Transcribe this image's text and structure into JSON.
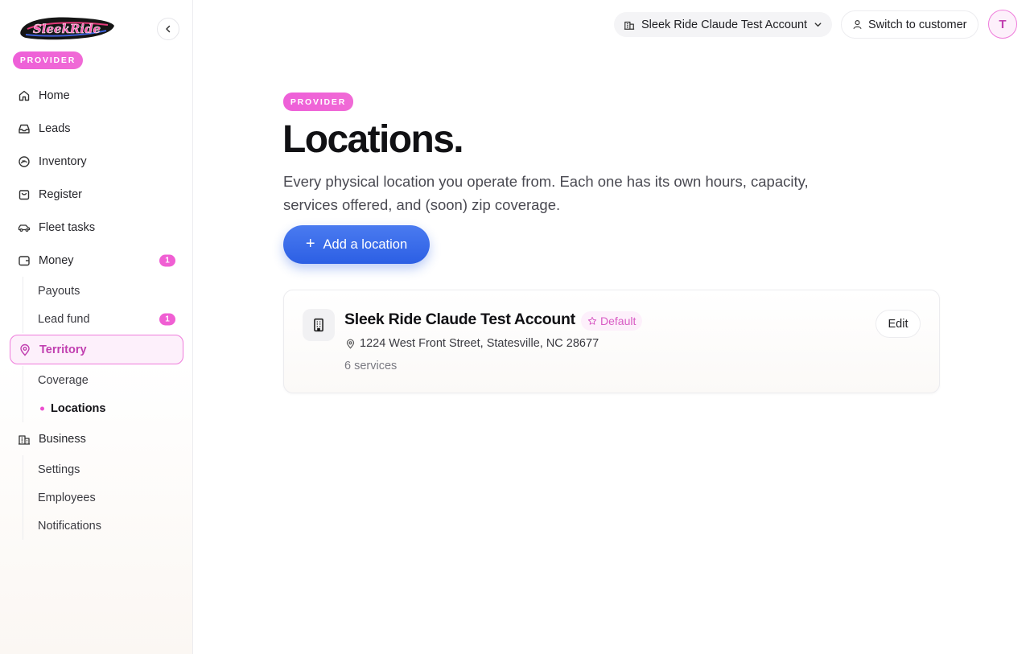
{
  "brand": {
    "logo_text": "SleekRide",
    "role_badge": "PROVIDER",
    "accent_color": "#f05fd3",
    "primary_color": "#2c5fe4"
  },
  "sidebar": {
    "items": [
      {
        "id": "home",
        "label": "Home",
        "icon": "home-icon"
      },
      {
        "id": "leads",
        "label": "Leads",
        "icon": "inbox-icon"
      },
      {
        "id": "inventory",
        "label": "Inventory",
        "icon": "jetski-icon"
      },
      {
        "id": "register",
        "label": "Register",
        "icon": "shopping-bag-icon"
      },
      {
        "id": "fleet-tasks",
        "label": "Fleet tasks",
        "icon": "car-icon"
      },
      {
        "id": "money",
        "label": "Money",
        "icon": "wallet-icon",
        "badge": "1",
        "children": [
          {
            "id": "payouts",
            "label": "Payouts"
          },
          {
            "id": "lead-fund",
            "label": "Lead fund",
            "badge": "1"
          }
        ]
      },
      {
        "id": "territory",
        "label": "Territory",
        "icon": "map-pin-icon",
        "active": true,
        "children": [
          {
            "id": "coverage",
            "label": "Coverage"
          },
          {
            "id": "locations",
            "label": "Locations",
            "current": true
          }
        ]
      },
      {
        "id": "business",
        "label": "Business",
        "icon": "building-icon",
        "children": [
          {
            "id": "settings",
            "label": "Settings"
          },
          {
            "id": "employees",
            "label": "Employees"
          },
          {
            "id": "notifications",
            "label": "Notifications"
          }
        ]
      }
    ]
  },
  "topbar": {
    "account_name": "Sleek Ride Claude Test Account",
    "switch_label": "Switch to customer",
    "avatar_initial": "T"
  },
  "main": {
    "badge": "PROVIDER",
    "title": "Locations.",
    "description": "Every physical location you operate from. Each one has its own hours, capacity, services offered, and (soon) zip coverage.",
    "add_button": "Add a location",
    "locations": [
      {
        "name": "Sleek Ride Claude Test Account",
        "default_label": "Default",
        "address": "1224 West Front Street, Statesville, NC 28677",
        "services": "6 services",
        "edit_label": "Edit"
      }
    ]
  }
}
